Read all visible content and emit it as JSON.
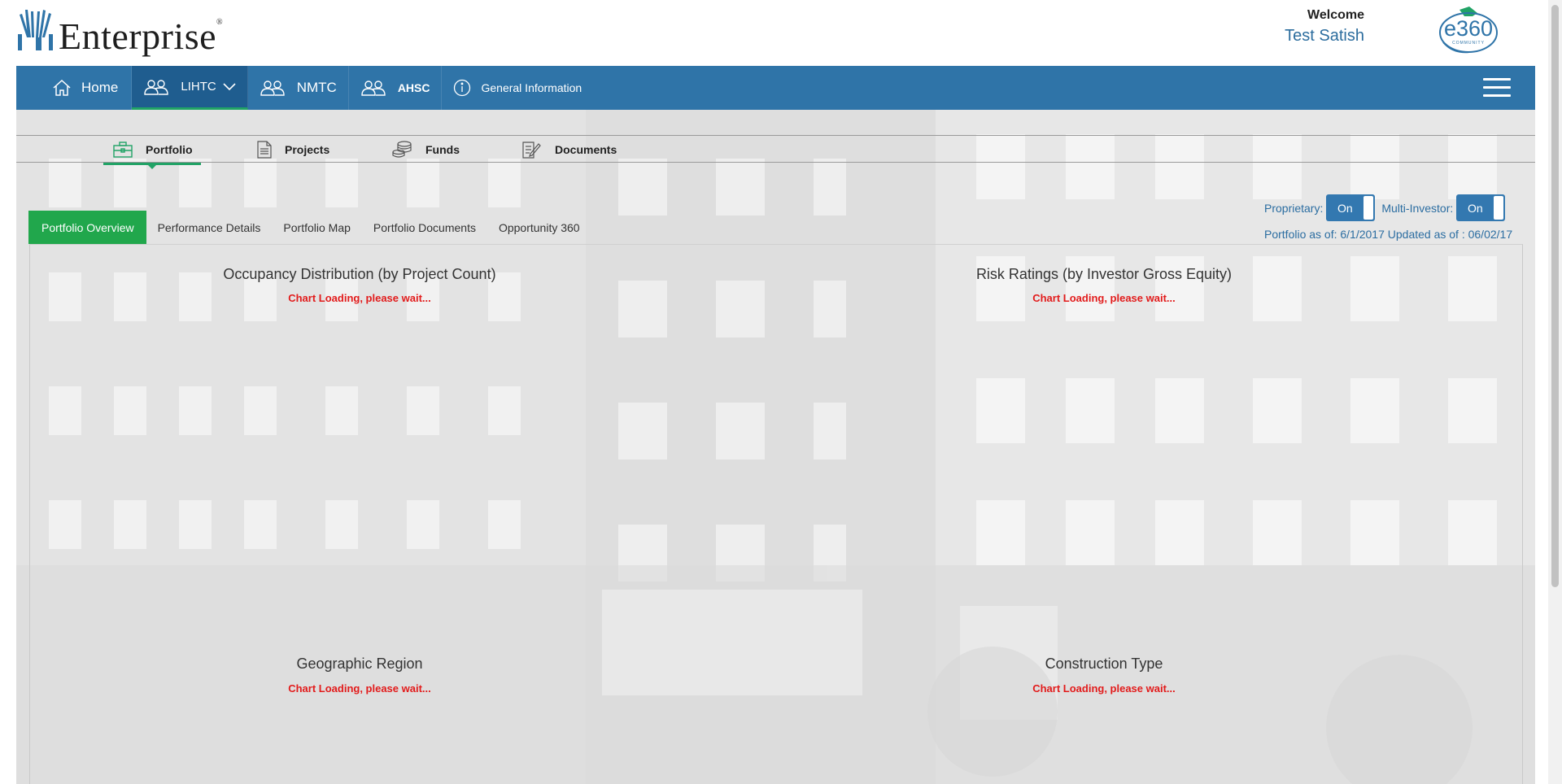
{
  "header": {
    "logo_text": "Enterprise",
    "logo_mark": "®",
    "welcome_label": "Welcome",
    "user_name": "Test Satish",
    "badge_text": "e360",
    "badge_sub": "COMMUNITY"
  },
  "mainnav": {
    "items": [
      {
        "label": "Home",
        "icon": "home-icon"
      },
      {
        "label": "LIHTC",
        "icon": "people-icon"
      },
      {
        "label": "NMTC",
        "icon": "people-icon"
      },
      {
        "label": "AHSC",
        "icon": "people-icon"
      },
      {
        "label": "General Information",
        "icon": "info-icon"
      }
    ],
    "active": "LIHTC",
    "menu_icon": "hamburger-icon"
  },
  "subnav": {
    "items": [
      {
        "label": "Portfolio",
        "icon": "briefcase-icon"
      },
      {
        "label": "Projects",
        "icon": "document-icon"
      },
      {
        "label": "Funds",
        "icon": "coins-icon"
      },
      {
        "label": "Documents",
        "icon": "edit-document-icon"
      }
    ],
    "active": "Portfolio"
  },
  "tabs": {
    "items": [
      "Portfolio Overview",
      "Performance Details",
      "Portfolio Map",
      "Portfolio Documents",
      "Opportunity 360"
    ],
    "active": "Portfolio Overview"
  },
  "toggles": {
    "proprietary_label": "Proprietary:",
    "proprietary_value": "On",
    "multi_investor_label": "Multi-Investor:",
    "multi_investor_value": "On"
  },
  "as_of": "Portfolio as of: 6/1/2017 Updated as of : 06/02/17",
  "charts": [
    {
      "title": "Occupancy Distribution (by Project Count)",
      "status": "Chart Loading, please wait..."
    },
    {
      "title": "Risk Ratings (by Investor Gross Equity)",
      "status": "Chart Loading, please wait..."
    },
    {
      "title": "Geographic Region",
      "status": "Chart Loading, please wait..."
    },
    {
      "title": "Construction Type",
      "status": "Chart Loading, please wait..."
    }
  ],
  "colors": {
    "nav_blue": "#2f74a8",
    "active_green": "#21a74c",
    "link_blue": "#2b6da1",
    "loading_red": "#e21b1b"
  }
}
